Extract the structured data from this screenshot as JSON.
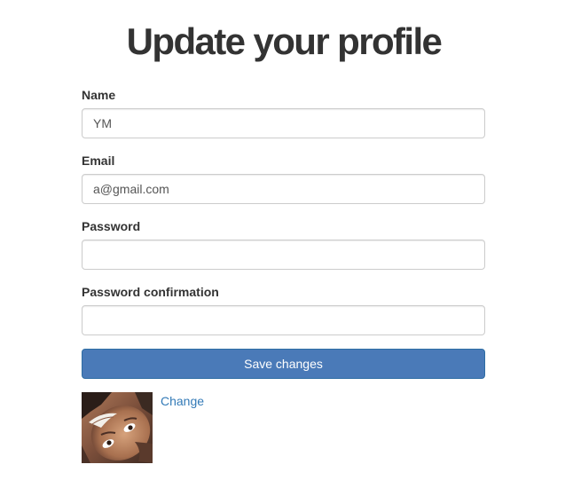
{
  "page": {
    "title": "Update your profile"
  },
  "form": {
    "name": {
      "label": "Name",
      "value": "YM",
      "type": "text"
    },
    "email": {
      "label": "Email",
      "value": "a@gmail.com",
      "type": "email"
    },
    "password": {
      "label": "Password",
      "value": "",
      "type": "password"
    },
    "password_confirmation": {
      "label": "Password confirmation",
      "value": "",
      "type": "password"
    },
    "submit_label": "Save changes"
  },
  "gravatar": {
    "avatar_icon": "user-photo",
    "change_label": "Change"
  },
  "colors": {
    "primary_button": "#4a7ab8",
    "link": "#337ab7",
    "input_border": "#cccccc",
    "text": "#333333"
  }
}
